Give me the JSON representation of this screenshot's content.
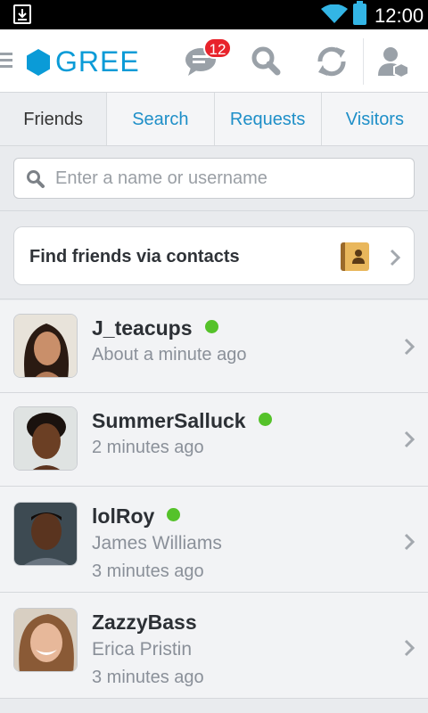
{
  "status_bar": {
    "time": "12:00",
    "wifi_icon": "wifi-icon",
    "battery_icon": "battery-icon",
    "download_icon": "download-icon"
  },
  "header": {
    "logo_text": "GREE",
    "message_badge_count": "12",
    "icons": [
      "menu-icon",
      "chat-icon",
      "search-icon",
      "refresh-icon",
      "profile-icon"
    ],
    "accent_color": "#0a9bd7",
    "badge_color": "#e8232b"
  },
  "tabs": [
    {
      "label": "Friends",
      "active": true
    },
    {
      "label": "Search",
      "active": false
    },
    {
      "label": "Requests",
      "active": false
    },
    {
      "label": "Visitors",
      "active": false
    }
  ],
  "search": {
    "placeholder": "Enter a name or username",
    "value": ""
  },
  "find_contacts": {
    "label": "Find friends via contacts"
  },
  "friends": [
    {
      "username": "J_teacups",
      "real_name": "",
      "time": "About a minute ago",
      "online": true
    },
    {
      "username": "SummerSalluck",
      "real_name": "",
      "time": "2 minutes ago",
      "online": true
    },
    {
      "username": "lolRoy",
      "real_name": "James Williams",
      "time": "3 minutes ago",
      "online": true
    },
    {
      "username": "ZazzyBass",
      "real_name": "Erica Pristin",
      "time": "3 minutes ago",
      "online": false
    }
  ],
  "online_color": "#55c22a"
}
